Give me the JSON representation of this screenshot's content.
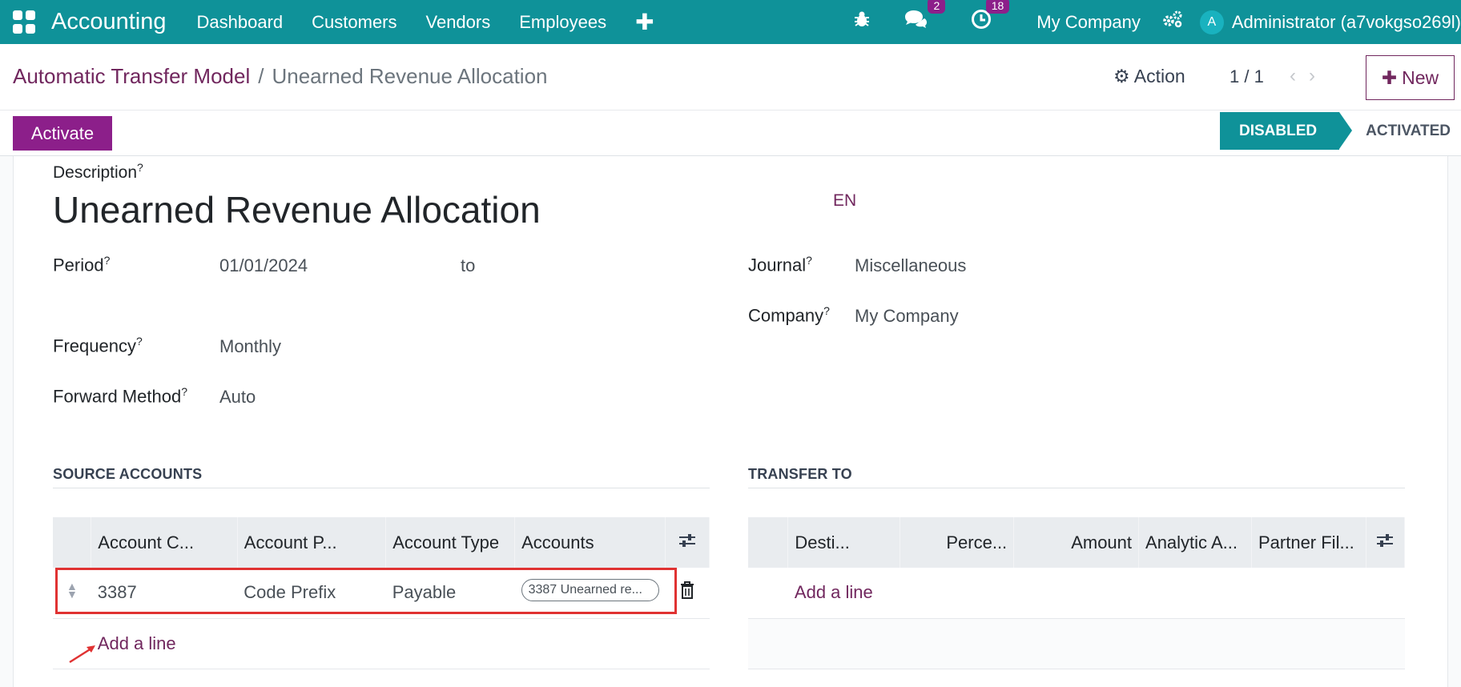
{
  "navbar": {
    "app_name": "Accounting",
    "menu": [
      "Dashboard",
      "Customers",
      "Vendors",
      "Employees"
    ],
    "plus": "✚",
    "messages_count": "2",
    "activities_count": "18",
    "company": "My Company",
    "avatar_letter": "A",
    "user": "Administrator (a7vokgso269l)"
  },
  "breadcrumb": {
    "parent": "Automatic Transfer Model",
    "separator": "/",
    "current": "Unearned Revenue Allocation"
  },
  "control": {
    "action_label": "Action",
    "pager": "1 / 1",
    "new_label": "New",
    "activate_label": "Activate",
    "status_disabled": "DISABLED",
    "status_activated": "ACTIVATED"
  },
  "form": {
    "description_label": "Description",
    "title": "Unearned Revenue Allocation",
    "lang": "EN",
    "period_label": "Period",
    "period_from": "01/01/2024",
    "period_to_label": "to",
    "journal_label": "Journal",
    "journal": "Miscellaneous",
    "company_label": "Company",
    "company": "My Company",
    "frequency_label": "Frequency",
    "frequency": "Monthly",
    "forward_method_label": "Forward Method",
    "forward_method": "Auto",
    "help_mark": "?"
  },
  "source_accounts": {
    "title": "SOURCE ACCOUNTS",
    "columns": [
      "Account C...",
      "Account P...",
      "Account Type",
      "Accounts"
    ],
    "row": {
      "code": "3387",
      "prefix": "Code Prefix",
      "type": "Payable",
      "account_tag": "3387 Unearned re..."
    },
    "add_line": "Add a line"
  },
  "transfer_to": {
    "title": "TRANSFER TO",
    "columns": [
      "Desti...",
      "Perce...",
      "Amount",
      "Analytic A...",
      "Partner Fil..."
    ],
    "add_line": "Add a line"
  },
  "colors": {
    "navbar": "#0f9299",
    "primary": "#8c1f8a",
    "link": "#71275e",
    "highlight": "#e03232"
  }
}
